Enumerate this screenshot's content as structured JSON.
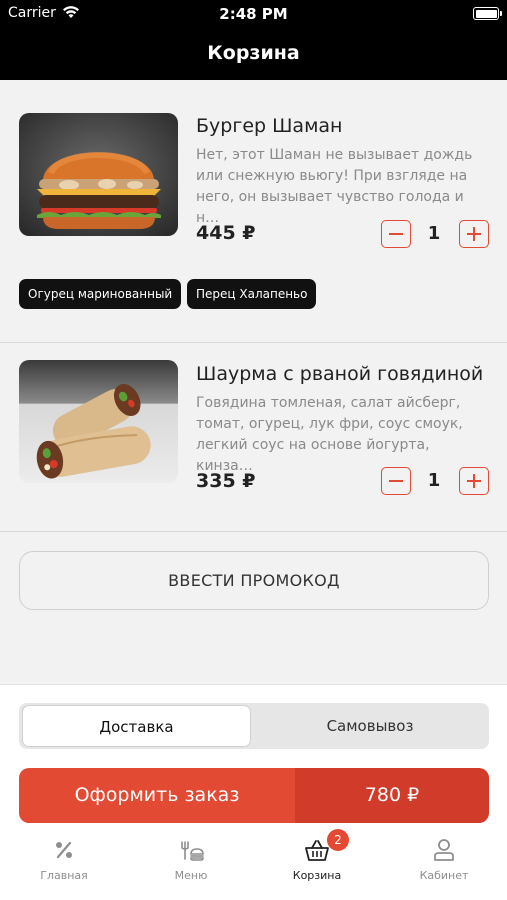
{
  "status_bar": {
    "carrier": "Carrier",
    "time": "2:48 PM",
    "icons": [
      "wifi-icon",
      "battery-icon"
    ]
  },
  "nav": {
    "title": "Корзина"
  },
  "cart": {
    "items": [
      {
        "name": "Бургер Шаман",
        "description": "Нет, этот Шаман не вызывает дождь или снежную вьюгу! При взгляде на него, он вызывает чувство голода и н…",
        "price": "445 ₽",
        "quantity": "1",
        "image_icon": "burger-photo",
        "options": [
          "Огурец маринованный",
          "Перец Халапеньо"
        ]
      },
      {
        "name": "Шаурма с рваной говядиной",
        "description": "Говядина томленая, салат айсберг, томат, огурец, лук фри, соус смоук, легкий соус на основе йогурта, кинза…",
        "price": "335 ₽",
        "quantity": "1",
        "image_icon": "shawarma-photo",
        "options": []
      }
    ]
  },
  "promo": {
    "label": "ВВЕСТИ ПРОМОКОД"
  },
  "delivery_toggle": {
    "options": [
      "Доставка",
      "Самовывоз"
    ],
    "selected": "Доставка"
  },
  "checkout": {
    "label": "Оформить заказ",
    "total": "780 ₽"
  },
  "tab_bar": {
    "tabs": [
      {
        "label": "Главная",
        "icon": "percent-icon"
      },
      {
        "label": "Меню",
        "icon": "menu-food-icon"
      },
      {
        "label": "Корзина",
        "icon": "basket-icon",
        "badge": "2"
      },
      {
        "label": "Кабинет",
        "icon": "user-icon"
      }
    ],
    "active": "Корзина"
  },
  "colors": {
    "accent": "#e24a33",
    "accent_dark": "#d03c29",
    "header_bg": "#000000",
    "page_bg": "#f2f2f2",
    "tag_bg": "#111111"
  }
}
